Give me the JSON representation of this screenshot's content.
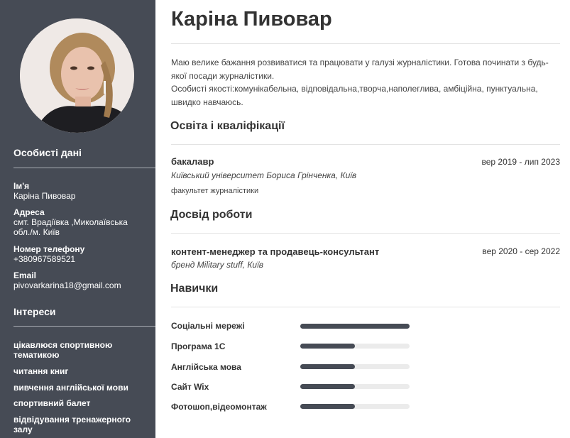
{
  "name": "Каріна Пивовар",
  "summary": [
    "Маю велике бажання розвиватися та працювати у галузі журналістики. Готова починати з будь-якої посади журналістики.",
    "Особисті якості:комунікабельна, відповідальна,творча,наполеглива, амбіційна, пунктуальна, швидко навчаюсь."
  ],
  "sidebar": {
    "personal_heading": "Особисті дані",
    "name_label": "Ім'я",
    "name_value": "Каріна Пивовар",
    "address_label": "Адреса",
    "address_value": "смт. Врадіївка ,Миколаївська обл./м. Київ",
    "phone_label": "Номер телефону",
    "phone_value": "+380967589521",
    "email_label": "Email",
    "email_value": "pivovarkarina18@gmail.com",
    "interests_heading": "Інтереси",
    "interests": [
      "цікавлюся спортивною тематикою",
      "читання книг",
      "вивчення англійської мови",
      "спортивний балет",
      "відвідування тренажерного залу"
    ]
  },
  "education": {
    "heading": "Освіта і кваліфікації",
    "degree": "бакалавр",
    "dates": "вер 2019 - лип 2023",
    "institution": "Київський університет Бориса Грінченка, Київ",
    "faculty": "факультет журналістики"
  },
  "experience": {
    "heading": "Досвід роботи",
    "position": "контент-менеджер та продавець-консультант",
    "dates": "вер 2020 - сер 2022",
    "company": "бренд Military stuff, Київ"
  },
  "skills": {
    "heading": "Навички",
    "items": [
      {
        "name": "Соціальні мережі",
        "level": 1.0
      },
      {
        "name": "Програма 1С",
        "level": 0.5
      },
      {
        "name": "Англійська мова",
        "level": 0.5
      },
      {
        "name": "Сайт Wix",
        "level": 0.5
      },
      {
        "name": "Фотошоп,відеомонтаж",
        "level": 0.5
      }
    ]
  },
  "colors": {
    "sidebar": "#464b55",
    "bar_fill": "#464b55",
    "bar_track": "#ebebeb"
  },
  "icons": {
    "photo": "profile-photo"
  }
}
